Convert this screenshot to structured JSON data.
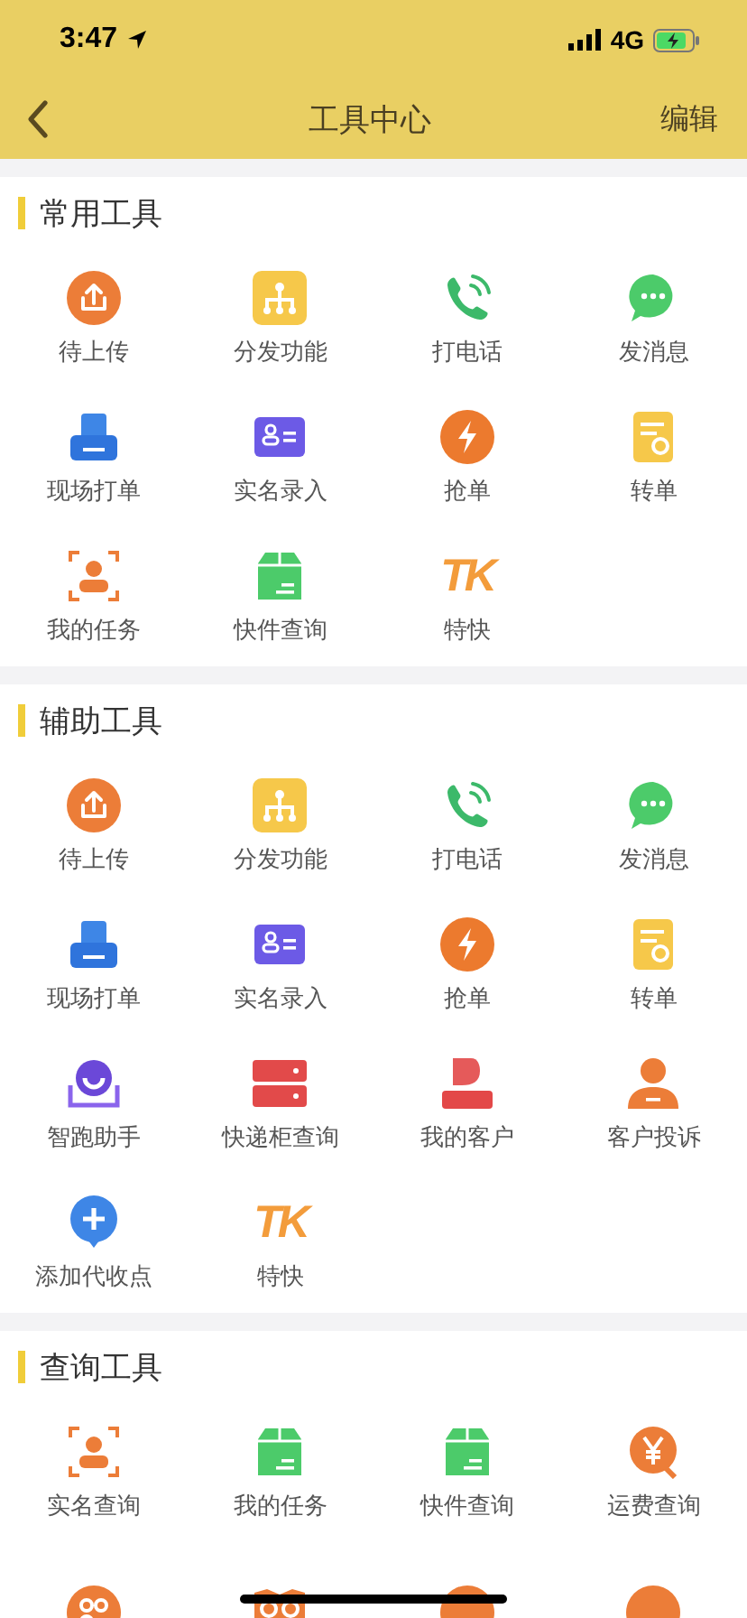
{
  "status_bar": {
    "time": "3:47",
    "network": "4G"
  },
  "nav": {
    "title": "工具中心",
    "action": "编辑"
  },
  "sections": [
    {
      "title": "常用工具",
      "items": [
        {
          "label": "待上传",
          "kind": "upload"
        },
        {
          "label": "分发功能",
          "kind": "org"
        },
        {
          "label": "打电话",
          "kind": "phone"
        },
        {
          "label": "发消息",
          "kind": "chat"
        },
        {
          "label": "现场打单",
          "kind": "printer"
        },
        {
          "label": "实名录入",
          "kind": "idcard"
        },
        {
          "label": "抢单",
          "kind": "bolt"
        },
        {
          "label": "转单",
          "kind": "transfer"
        },
        {
          "label": "我的任务",
          "kind": "scan"
        },
        {
          "label": "快件查询",
          "kind": "box"
        },
        {
          "label": "特快",
          "kind": "tk",
          "logo_text": "TK"
        }
      ]
    },
    {
      "title": "辅助工具",
      "items": [
        {
          "label": "待上传",
          "kind": "upload"
        },
        {
          "label": "分发功能",
          "kind": "org"
        },
        {
          "label": "打电话",
          "kind": "phone"
        },
        {
          "label": "发消息",
          "kind": "chat"
        },
        {
          "label": "现场打单",
          "kind": "printer"
        },
        {
          "label": "实名录入",
          "kind": "idcard"
        },
        {
          "label": "抢单",
          "kind": "bolt"
        },
        {
          "label": "转单",
          "kind": "transfer"
        },
        {
          "label": "智跑助手",
          "kind": "assistant"
        },
        {
          "label": "快递柜查询",
          "kind": "locker"
        },
        {
          "label": "我的客户",
          "kind": "customer"
        },
        {
          "label": "客户投诉",
          "kind": "person"
        },
        {
          "label": "添加代收点",
          "kind": "plus"
        },
        {
          "label": "特快",
          "kind": "tk",
          "logo_text": "TK"
        }
      ]
    },
    {
      "title": "查询工具",
      "items": [
        {
          "label": "实名查询",
          "kind": "scan"
        },
        {
          "label": "我的任务",
          "kind": "box"
        },
        {
          "label": "快件查询",
          "kind": "box"
        },
        {
          "label": "运费查询",
          "kind": "yuan"
        },
        {
          "kind": "group"
        },
        {
          "kind": "glasses"
        },
        {
          "kind": "circle"
        },
        {
          "kind": "circle"
        }
      ]
    }
  ]
}
